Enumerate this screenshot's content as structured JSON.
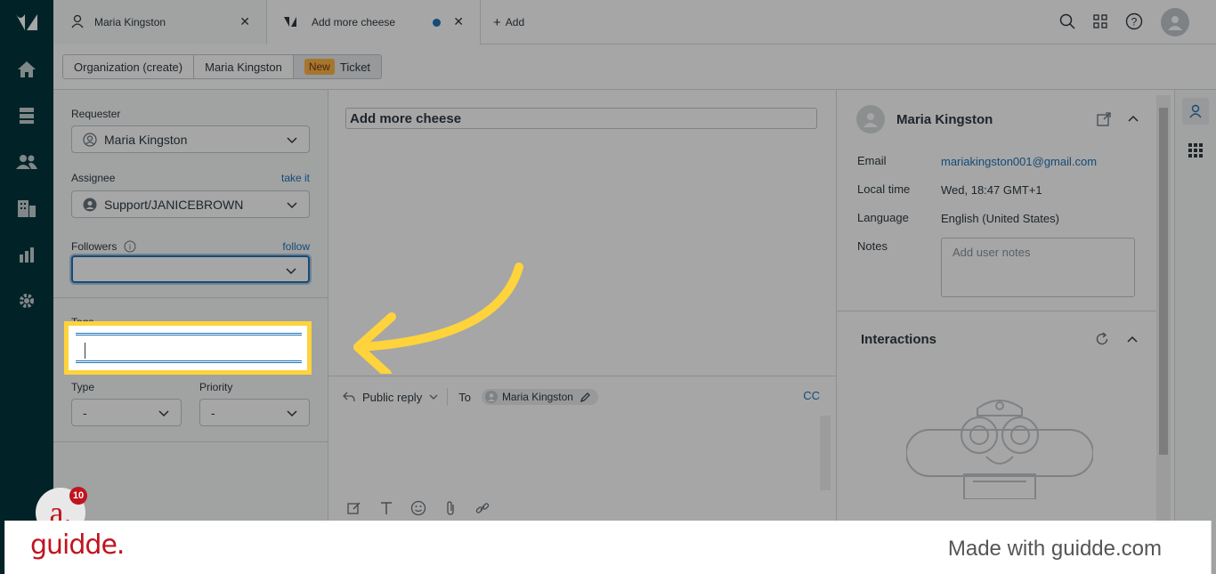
{
  "tabs": [
    {
      "label": "Maria Kingston",
      "icon": "user-icon"
    },
    {
      "label": "Add more cheese",
      "icon": "ticket-icon"
    }
  ],
  "add_tab_label": "Add",
  "breadcrumbs": {
    "org": "Organization (create)",
    "user": "Maria Kingston",
    "badge": "New",
    "ticket": "Ticket"
  },
  "props": {
    "requester_label": "Requester",
    "requester_value": "Maria Kingston",
    "assignee_label": "Assignee",
    "assignee_link": "take it",
    "assignee_value": "Support/JANICEBROWN",
    "followers_label": "Followers",
    "followers_link": "follow",
    "tags_label": "Tags",
    "type_label": "Type",
    "type_value": "-",
    "priority_label": "Priority",
    "priority_value": "-"
  },
  "ticket": {
    "subject": "Add more cheese",
    "reply_mode": "Public reply",
    "to_label": "To",
    "to_chip": "Maria Kingston",
    "cc_label": "CC"
  },
  "user_panel": {
    "name": "Maria Kingston",
    "email_label": "Email",
    "email_value": "mariakingston001@gmail.com",
    "local_time_label": "Local time",
    "local_time_value": "Wed, 18:47 GMT+1",
    "language_label": "Language",
    "language_value": "English (United States)",
    "notes_label": "Notes",
    "notes_placeholder": "Add user notes",
    "interactions_label": "Interactions"
  },
  "guidde": {
    "badge_letter": "a.",
    "badge_count": "10",
    "brand": "guidde.",
    "made_with": "Made with guidde.com"
  },
  "colors": {
    "nav_bg": "#03363d",
    "highlight": "#fed33b",
    "link": "#1f73b7",
    "brand_red": "#c0141e"
  }
}
